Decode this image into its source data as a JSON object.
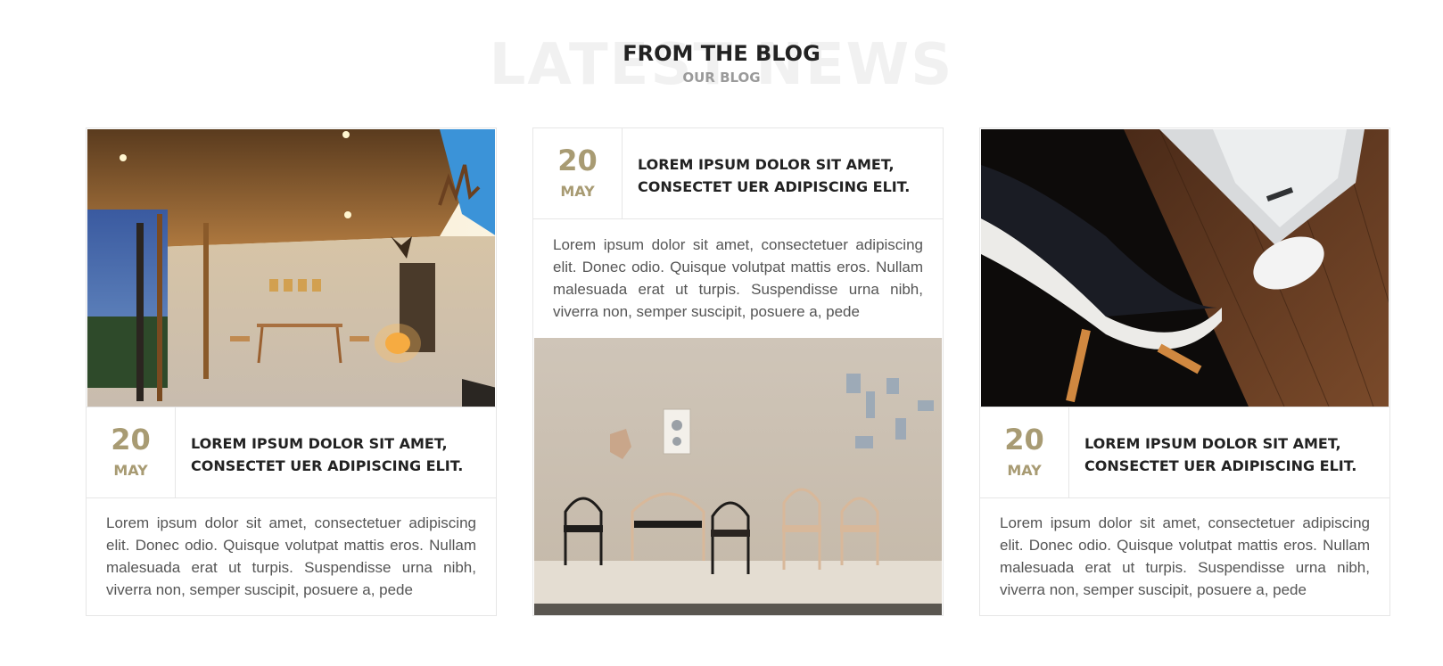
{
  "section": {
    "ghost_text": "LATEST NEWS",
    "title": "FROM THE BLOG",
    "subtitle": "OUR BLOG"
  },
  "posts": [
    {
      "day": "20",
      "month": "MAY",
      "title": "LOREM IPSUM DOLOR SIT AMET, CONSECTET UER ADIPISCING ELIT.",
      "excerpt": "Lorem ipsum dolor sit amet, consectetuer adipiscing elit. Donec odio. Quisque volutpat mattis eros. Nullam malesuada erat ut turpis. Suspendisse urna nibh, viverra non, semper suscipit, posuere a, pede",
      "image": "dining-room-photo"
    },
    {
      "day": "20",
      "month": "MAY",
      "title": "LOREM IPSUM DOLOR SIT AMET, CONSECTET UER ADIPISCING ELIT.",
      "excerpt": "Lorem ipsum dolor sit amet, consectetuer adipiscing elit. Donec odio. Quisque volutpat mattis eros. Nullam malesuada erat ut turpis. Suspendisse urna nibh, viverra non, semper suscipit, posuere a, pede",
      "image": "chairs-photo"
    },
    {
      "day": "20",
      "month": "MAY",
      "title": "LOREM IPSUM DOLOR SIT AMET, CONSECTET UER ADIPISCING ELIT.",
      "excerpt": "Lorem ipsum dolor sit amet, consectetuer adipiscing elit. Donec odio. Quisque volutpat mattis eros. Nullam malesuada erat ut turpis. Suspendisse urna nibh, viverra non, semper suscipit, posuere a, pede",
      "image": "laptop-desk-photo"
    }
  ],
  "colors": {
    "accent": "#a89b73",
    "heading": "#222222",
    "muted": "#9a9a9a",
    "body_text": "#555555",
    "border": "#e6e6e6"
  }
}
